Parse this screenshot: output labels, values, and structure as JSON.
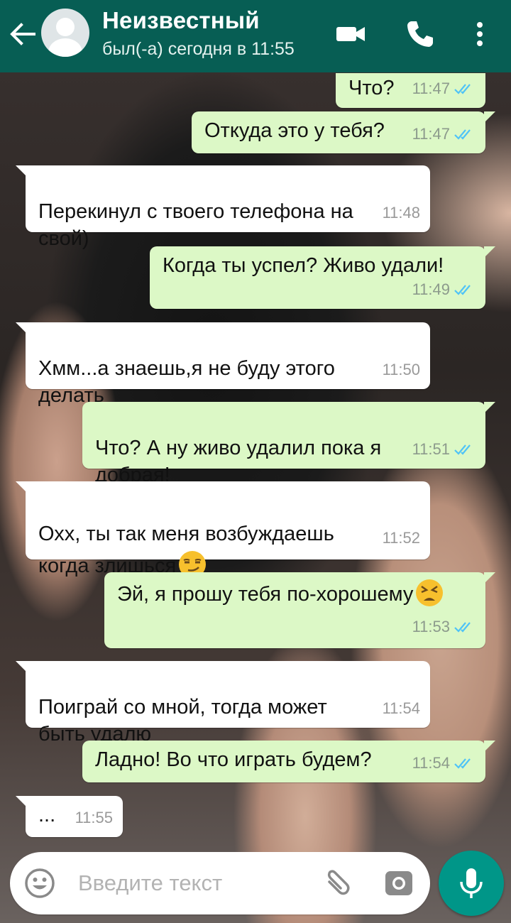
{
  "header": {
    "contact_name": "Неизвестный",
    "status": "был(-а) сегодня в 11:55",
    "accent_color": "#075e54"
  },
  "messages": [
    {
      "dir": "out",
      "text": "Что?",
      "time": "11:47",
      "read": true
    },
    {
      "dir": "out",
      "text": "Откуда это у тебя?",
      "time": "11:47",
      "read": true
    },
    {
      "dir": "in",
      "text": "Перекинул с твоего телефона на\nсвой)",
      "time": "11:48"
    },
    {
      "dir": "out",
      "text": "Когда ты успел? Живо удали!",
      "time": "11:49",
      "read": true
    },
    {
      "dir": "in",
      "text": "Хмм...а знаешь,я не буду этого\nделать",
      "time": "11:50"
    },
    {
      "dir": "out",
      "text": "Что? А ну живо удалил пока я\nдобрая!",
      "time": "11:51",
      "read": true
    },
    {
      "dir": "in",
      "text": "Охх, ты так меня возбуждаешь\nкогда злишься",
      "emoji": "smirk-emoji",
      "time": "11:52"
    },
    {
      "dir": "out",
      "text": "Эй, я прошу тебя по-хорошему",
      "emoji": "tired-face-emoji",
      "time": "11:53",
      "read": true
    },
    {
      "dir": "in",
      "text": "Поиграй со мной, тогда  может\nбыть удалю",
      "time": "11:54"
    },
    {
      "dir": "out",
      "text": "Ладно! Во что играть будем?",
      "time": "11:54",
      "read": true
    },
    {
      "dir": "in",
      "text": "...",
      "time": "11:55"
    }
  ],
  "composer": {
    "placeholder": "Введите текст"
  },
  "colors": {
    "outgoing_bubble": "#dcf8c6",
    "incoming_bubble": "#ffffff",
    "read_ticks": "#4fc3f7",
    "mic_button": "#009688"
  }
}
